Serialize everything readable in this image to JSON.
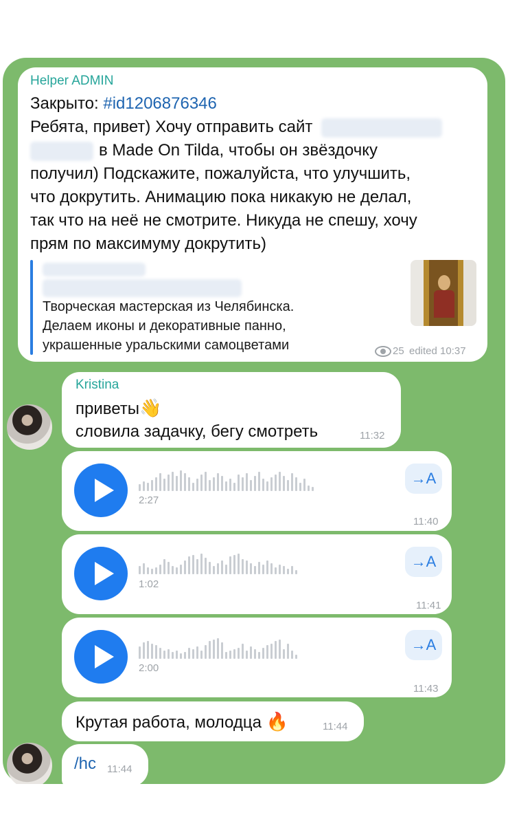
{
  "messages": {
    "first": {
      "sender": "Helper ADMIN",
      "closed_label": "Закрыто:",
      "closed_id": "#id1206876346",
      "line1": "Ребята, привет) Хочу отправить сайт",
      "line2": "в Made On Tilda, чтобы он звёздочку",
      "line3": "получил) Подскажите, пожалуйста, что улучшить,",
      "line4": "что докрутить. Анимацию пока никакую не делал,",
      "line5": "так что на неё не смотрите. Никуда не спешу, хочу",
      "line6": "прям по максимуму докрутить)",
      "preview_line1": "Творческая мастерская из Челябинска.",
      "preview_line2": "Делаем иконы и декоративные панно,",
      "preview_line3": "украшенные уральскими самоцветами",
      "views": "25",
      "edited_time": "edited 10:37"
    },
    "kristina_text": {
      "sender": "Kristina",
      "line1": "приветы",
      "line1_emoji": "👋",
      "line2": "словила задачку, бегу смотреть",
      "time": "11:32"
    },
    "voice": [
      {
        "duration": "2:27",
        "time": "11:40",
        "transcribe_label": "→A"
      },
      {
        "duration": "1:02",
        "time": "11:41",
        "transcribe_label": "→A"
      },
      {
        "duration": "2:00",
        "time": "11:43",
        "transcribe_label": "→A"
      }
    ],
    "praise": {
      "text": "Крутая работа, молодца",
      "emoji": "🔥",
      "time": "11:44"
    },
    "command": {
      "text": "/hc",
      "time": "11:44"
    }
  },
  "colors": {
    "chat_bg": "#7dba6c",
    "accent": "#1f7cef",
    "sender": "#26a59a"
  }
}
